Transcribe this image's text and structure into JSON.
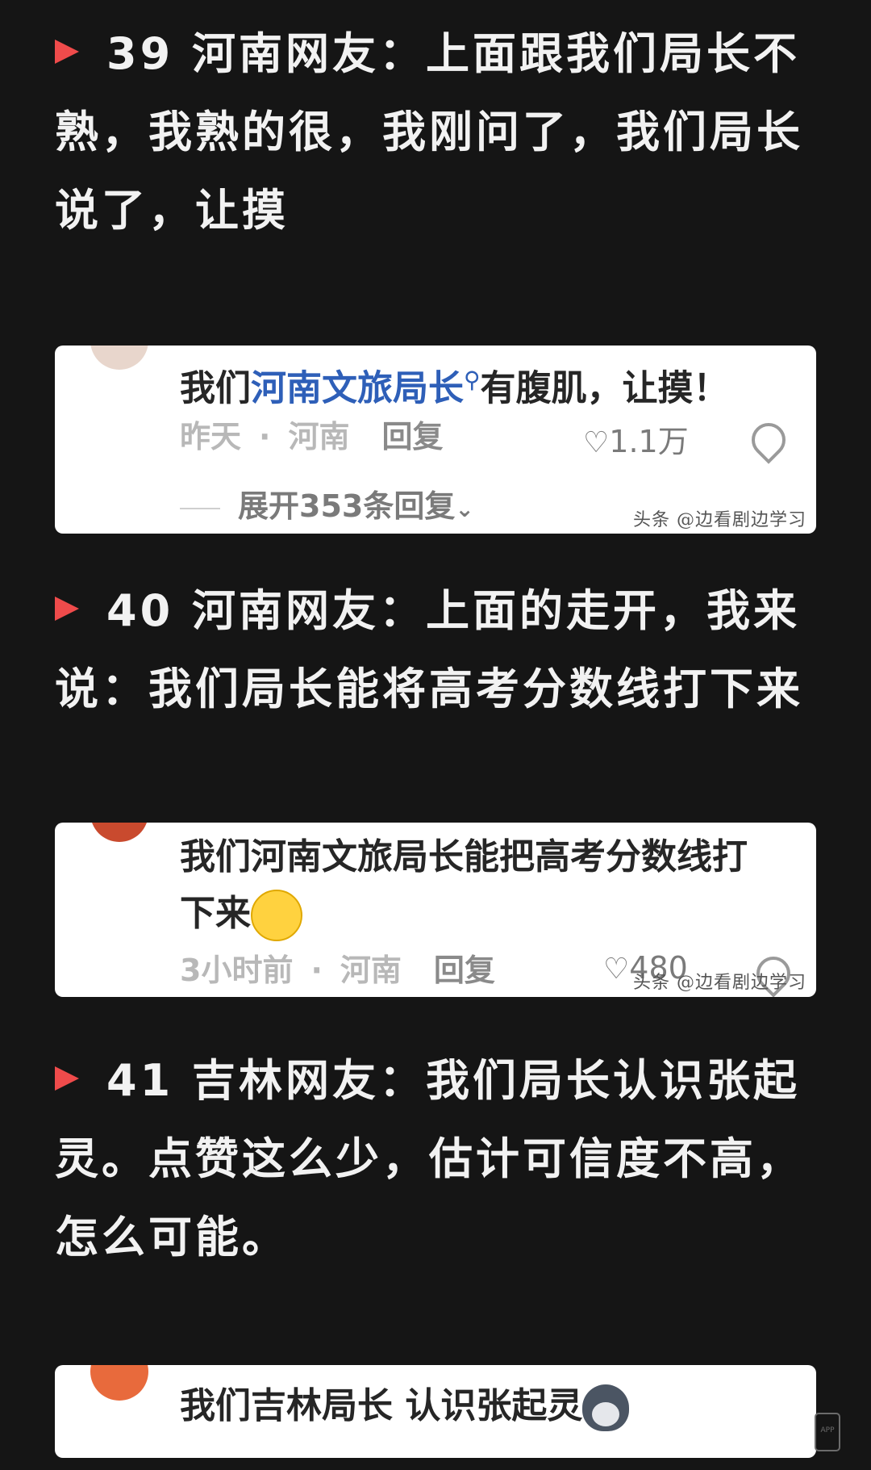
{
  "sections": [
    {
      "text": "39 河南网友：上面跟我们局长不熟，我熟的很，我刚问了，我们局长说了，让摸",
      "card": {
        "comment_prefix": "我们",
        "comment_link": "河南文旅局长",
        "comment_suffix": "有腹肌，让摸！",
        "time": "昨天",
        "location": "河南",
        "reply": "回复",
        "likes": "1.1万",
        "expand": "展开353条回复",
        "watermark": "头条 @边看剧边学习"
      }
    },
    {
      "text": "40 河南网友：上面的走开，我来说：我们局长能将高考分数线打下来",
      "card": {
        "comment": "我们河南文旅局长能把高考分数线打下来",
        "time": "3小时前",
        "location": "河南",
        "reply": "回复",
        "likes": "480",
        "watermark": "头条 @边看剧边学习"
      }
    },
    {
      "text": "41 吉林网友：我们局长认识张起灵。点赞这么少，估计可信度不高，怎么可能。",
      "card": {
        "comment": "我们吉林局长 认识张起灵"
      }
    }
  ],
  "app_icon_label": "APP",
  "colors": {
    "background": "#151515",
    "play_marker": "#ef4b4b",
    "topic_link": "#2e5fb8"
  }
}
